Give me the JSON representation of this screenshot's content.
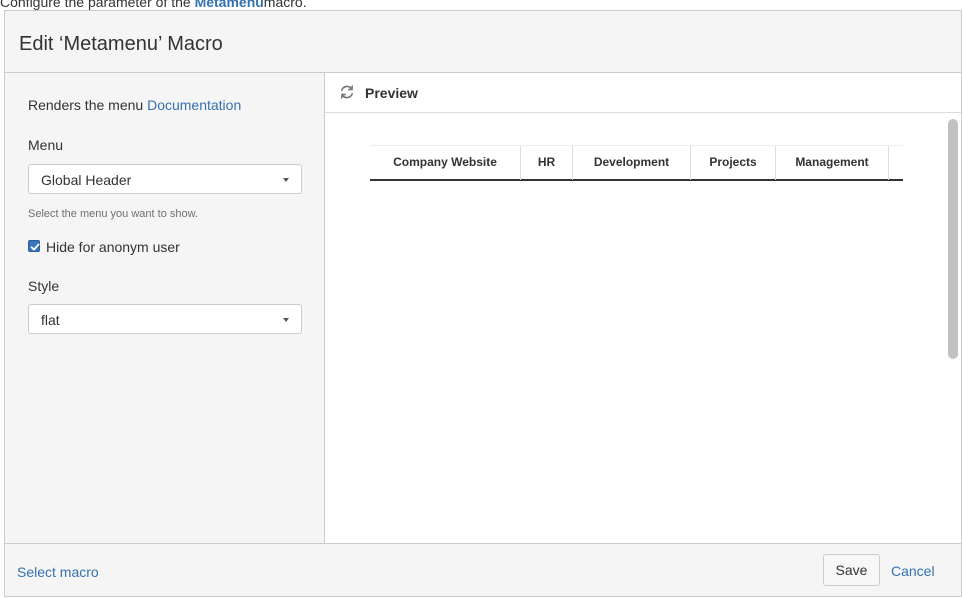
{
  "caption": {
    "prefix": "Configure the parameter of the ",
    "link": "Metamenu",
    "suffix": "macro."
  },
  "dialog": {
    "title": "Edit ‘Metamenu’ Macro"
  },
  "left_panel": {
    "description": "Renders the menu ",
    "documentation_link": "Documentation",
    "menu": {
      "label": "Menu",
      "selected": "Global Header",
      "help": "Select the menu you want to show."
    },
    "hide_anon": {
      "label": "Hide for anonym user",
      "checked": true
    },
    "style": {
      "label": "Style",
      "selected": "flat"
    }
  },
  "preview": {
    "title": "Preview",
    "menu_items": [
      {
        "label": "Company Website"
      },
      {
        "label": "HR"
      },
      {
        "label": "Development"
      },
      {
        "label": "Projects"
      },
      {
        "label": "Management"
      }
    ]
  },
  "footer": {
    "select_macro": "Select macro",
    "save": "Save",
    "cancel": "Cancel"
  },
  "colors": {
    "link": "#3572b0",
    "panel_bg": "#f5f5f5",
    "border": "#cccccc"
  }
}
